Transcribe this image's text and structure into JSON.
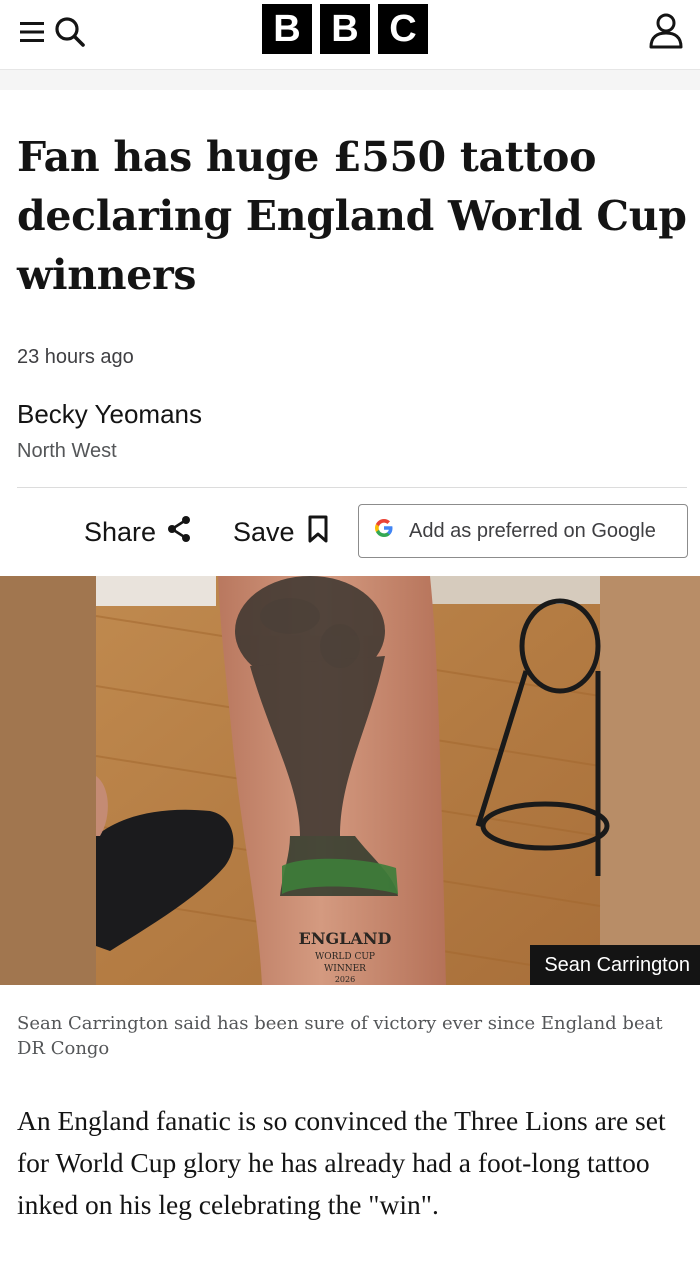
{
  "header": {
    "logo_letters": [
      "B",
      "B",
      "C"
    ],
    "icons": [
      "menu-icon",
      "search-icon",
      "account-icon"
    ]
  },
  "article": {
    "headline": "Fan has huge £550 tattoo declaring England World Cup winners",
    "timestamp": "23 hours ago",
    "author": "Becky Yeomans",
    "location": "North West"
  },
  "actions": {
    "share_label": "Share",
    "save_label": "Save",
    "google_label": "Add as preferred on Google"
  },
  "image": {
    "credit": "Sean Carrington",
    "tattoo_text": [
      "ENGLAND",
      "WORLD CUP",
      "WINNER",
      "2026"
    ],
    "caption": "Sean Carrington said has been sure of victory ever since England beat DR Congo"
  },
  "body": {
    "paragraph_1": "An England fanatic is so convinced the Three Lions are set for World Cup glory he has already had a foot-long tattoo inked on his leg celebrating the \"win\"."
  },
  "colors": {
    "brand": "#000000",
    "text": "#141414",
    "muted": "#545658",
    "google_blue": "#4285F4",
    "google_red": "#EA4335",
    "google_yellow": "#FBBC05",
    "google_green": "#34A853"
  }
}
